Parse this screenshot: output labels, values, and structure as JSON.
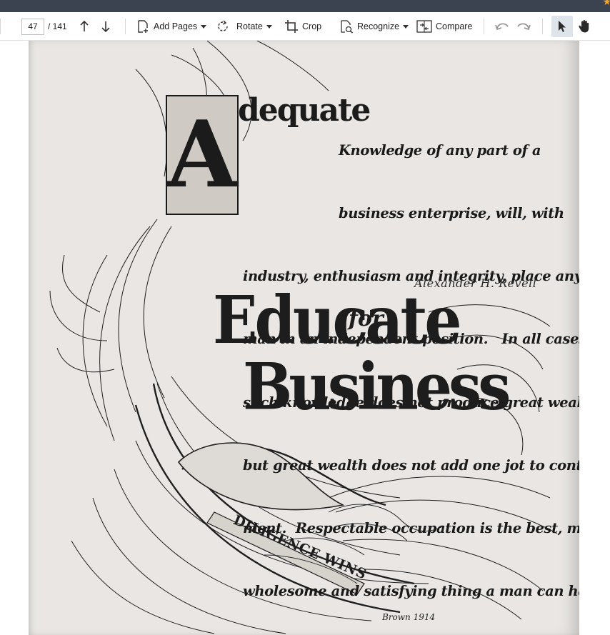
{
  "toolbar": {
    "page_current": "47",
    "page_total": "/ 141",
    "add_pages_label": "Add Pages",
    "rotate_label": "Rotate",
    "crop_label": "Crop",
    "recognize_label": "Recognize",
    "compare_label": "Compare",
    "icons": [
      "prev-page-icon",
      "next-page-icon",
      "add-pages-icon",
      "rotate-icon",
      "crop-icon",
      "recognize-icon",
      "compare-icon",
      "undo-icon",
      "redo-icon",
      "select-cursor-icon",
      "hand-icon"
    ],
    "accent_color": "#dfe3ea"
  },
  "document": {
    "initial_letter": "A",
    "initial_rest": "dequate",
    "body_lines": [
      "Knowledge of any part of a",
      "business enterprise, will, with",
      "industry, enthusiasm and integrity, place any",
      "man in an independent position.   In all cases",
      "such knowledge does not produce great wealth,",
      "but great wealth does not add one jot to content-",
      "ment.  Respectable occupation is the best, most",
      "wholesome and satisfying thing a man can have"
    ],
    "signature": "Alexander H. Revell",
    "heading_word1": "Educate",
    "heading_for": "for",
    "heading_word2": "Business",
    "ribbon_text": "DILIGENCE WINS",
    "artist_mark": "Brown 1914"
  }
}
